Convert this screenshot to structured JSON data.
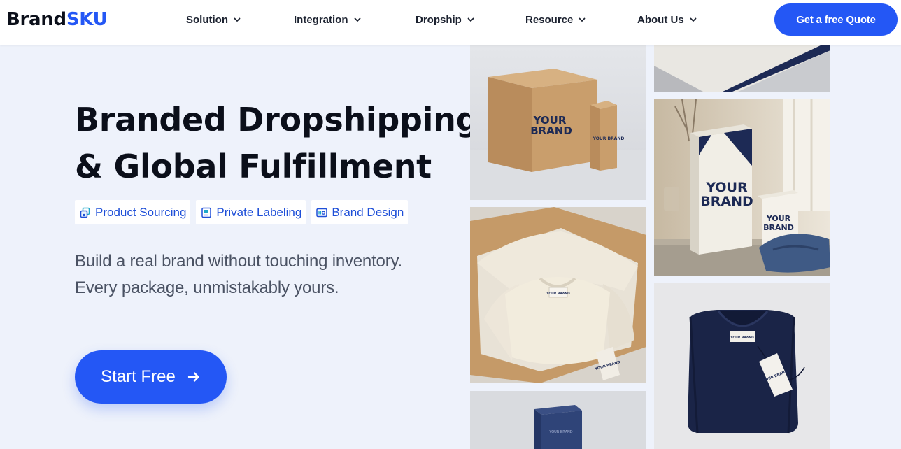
{
  "header": {
    "logo": {
      "brand": "Brand",
      "sku": "SKU"
    },
    "nav": [
      {
        "label": "Solution"
      },
      {
        "label": "Integration"
      },
      {
        "label": "Dropship"
      },
      {
        "label": "Resource"
      },
      {
        "label": "About Us"
      }
    ],
    "cta_label": "Get a free Quote"
  },
  "hero": {
    "title_line1": "Branded Dropshipping",
    "title_line2": "& Global Fulfillment",
    "tags": [
      {
        "label": "Product Sourcing",
        "icon": "sourcing-icon"
      },
      {
        "label": "Private Labeling",
        "icon": "label-icon"
      },
      {
        "label": "Brand Design",
        "icon": "design-icon"
      }
    ],
    "subtitle_line1": "Build a real brand without touching inventory.",
    "subtitle_line2": "Every package, unmistakably yours.",
    "start_label": "Start Free"
  },
  "gallery": {
    "box_text1": "YOUR",
    "box_text2": "BRAND",
    "small_box_text": "YOUR BRAND",
    "lid_text": "YOUR BRAND",
    "bottle_line1": "YOUR",
    "bottle_line2": "BRAND",
    "bottle_small1": "YOUR",
    "bottle_small2": "BRAND",
    "shirt_label": "YOUR BRAND",
    "hangtag": "YOUR BRAND"
  },
  "colors": {
    "accent": "#2457f5",
    "tag_text": "#1e4fd8",
    "background": "#eef2fb",
    "navy": "#1d2a55"
  }
}
